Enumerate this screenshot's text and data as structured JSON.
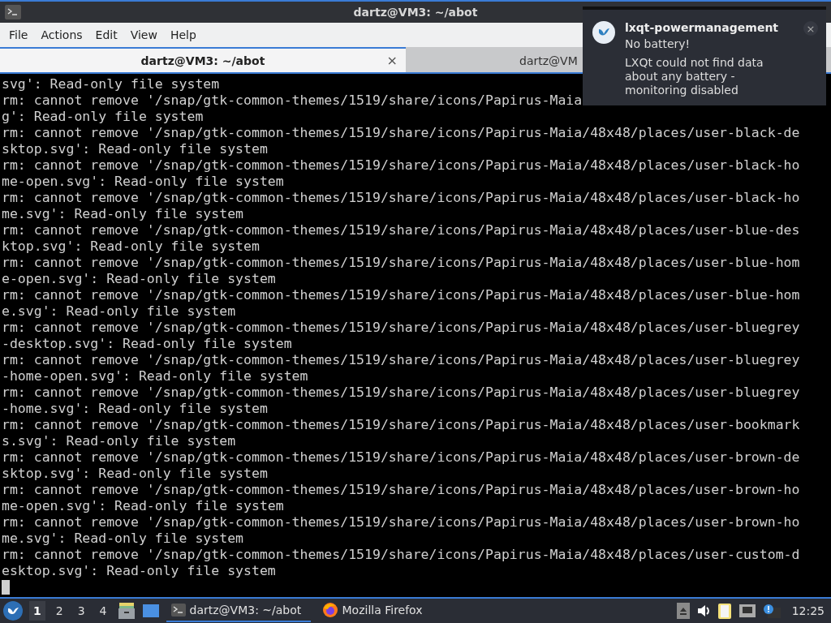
{
  "window": {
    "title": "dartz@VM3: ~/abot"
  },
  "menu": [
    "File",
    "Actions",
    "Edit",
    "View",
    "Help"
  ],
  "tabs": [
    {
      "label": "dartz@VM3: ~/abot",
      "selected": true,
      "close": "×"
    },
    {
      "label": "dartz@VM",
      "selected": false
    }
  ],
  "terminal": {
    "lines": [
      "svg': Read-only file system",
      "rm: cannot remove '/snap/gtk-common-themes/1519/share/icons/Papirus-Maia",
      "g': Read-only file system",
      "rm: cannot remove '/snap/gtk-common-themes/1519/share/icons/Papirus-Maia/48x48/places/user-black-de",
      "sktop.svg': Read-only file system",
      "rm: cannot remove '/snap/gtk-common-themes/1519/share/icons/Papirus-Maia/48x48/places/user-black-ho",
      "me-open.svg': Read-only file system",
      "rm: cannot remove '/snap/gtk-common-themes/1519/share/icons/Papirus-Maia/48x48/places/user-black-ho",
      "me.svg': Read-only file system",
      "rm: cannot remove '/snap/gtk-common-themes/1519/share/icons/Papirus-Maia/48x48/places/user-blue-des",
      "ktop.svg': Read-only file system",
      "rm: cannot remove '/snap/gtk-common-themes/1519/share/icons/Papirus-Maia/48x48/places/user-blue-hom",
      "e-open.svg': Read-only file system",
      "rm: cannot remove '/snap/gtk-common-themes/1519/share/icons/Papirus-Maia/48x48/places/user-blue-hom",
      "e.svg': Read-only file system",
      "rm: cannot remove '/snap/gtk-common-themes/1519/share/icons/Papirus-Maia/48x48/places/user-bluegrey",
      "-desktop.svg': Read-only file system",
      "rm: cannot remove '/snap/gtk-common-themes/1519/share/icons/Papirus-Maia/48x48/places/user-bluegrey",
      "-home-open.svg': Read-only file system",
      "rm: cannot remove '/snap/gtk-common-themes/1519/share/icons/Papirus-Maia/48x48/places/user-bluegrey",
      "-home.svg': Read-only file system",
      "rm: cannot remove '/snap/gtk-common-themes/1519/share/icons/Papirus-Maia/48x48/places/user-bookmark",
      "s.svg': Read-only file system",
      "rm: cannot remove '/snap/gtk-common-themes/1519/share/icons/Papirus-Maia/48x48/places/user-brown-de",
      "sktop.svg': Read-only file system",
      "rm: cannot remove '/snap/gtk-common-themes/1519/share/icons/Papirus-Maia/48x48/places/user-brown-ho",
      "me-open.svg': Read-only file system",
      "rm: cannot remove '/snap/gtk-common-themes/1519/share/icons/Papirus-Maia/48x48/places/user-brown-ho",
      "me.svg': Read-only file system",
      "rm: cannot remove '/snap/gtk-common-themes/1519/share/icons/Papirus-Maia/48x48/places/user-custom-d",
      "esktop.svg': Read-only file system"
    ]
  },
  "notification": {
    "app": "lxqt-powermanagement",
    "summary": "No battery!",
    "body": "LXQt could not find data about any battery - monitoring disabled",
    "close": "×"
  },
  "taskbar": {
    "desktops": [
      {
        "label": "1",
        "selected": true
      },
      {
        "label": "2",
        "selected": false
      },
      {
        "label": "3",
        "selected": false
      },
      {
        "label": "4",
        "selected": false
      }
    ],
    "tasks": [
      {
        "kind": "terminal",
        "label": "dartz@VM3: ~/abot",
        "selected": true
      },
      {
        "kind": "firefox",
        "label": "Mozilla Firefox",
        "selected": false
      }
    ],
    "clock": "12:25"
  }
}
